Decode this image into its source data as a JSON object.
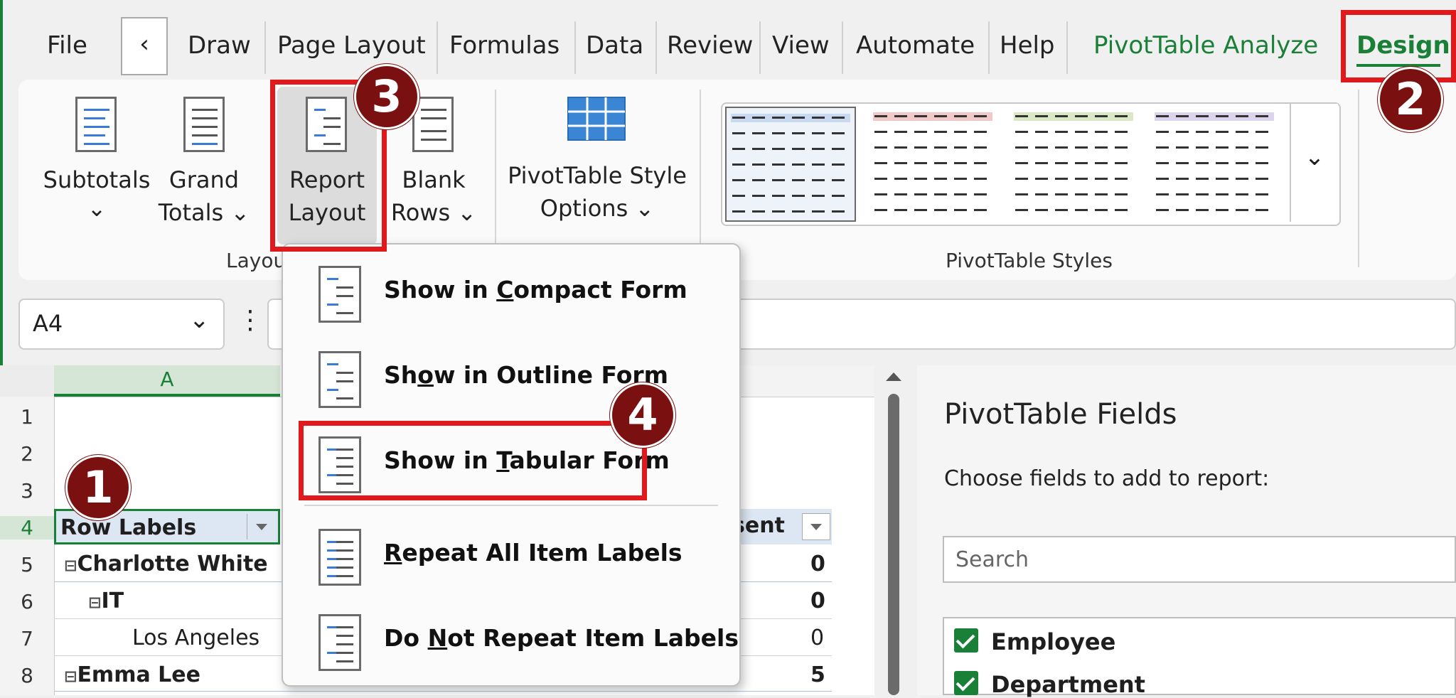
{
  "tabs": {
    "file": "File",
    "back": "‹",
    "draw": "Draw",
    "page_layout": "Page Layout",
    "formulas": "Formulas",
    "data": "Data",
    "review": "Review",
    "view": "View",
    "automate": "Automate",
    "help": "Help",
    "pivot_analyze": "PivotTable Analyze",
    "design": "Design"
  },
  "ribbon": {
    "subtotals": "Subtotals",
    "subtotals_caret": "⌄",
    "grand": "Grand",
    "totals": "Totals ⌄",
    "report": "Report",
    "layout": "Layout ⌄",
    "blank": "Blank",
    "rows": "Rows ⌄",
    "style_options_1": "PivotTable Style",
    "style_options_2": "Options ⌄",
    "group_layout": "Layou",
    "group_styles": "PivotTable Styles",
    "more": "⌄"
  },
  "menu": {
    "compact_pre": "Show in ",
    "compact_key": "C",
    "compact_post": "ompact Form",
    "outline_pre": "Sh",
    "outline_key": "o",
    "outline_post": "w in Outline Form",
    "tabular_pre": "Show in ",
    "tabular_key": "T",
    "tabular_post": "abular Form",
    "repeat_key": "R",
    "repeat_post": "epeat All Item Labels",
    "norepeat_pre": "Do ",
    "norepeat_key": "N",
    "norepeat_post": "ot Repeat Item Labels"
  },
  "namebox": {
    "value": "A4",
    "caret": "⌄",
    "dots": "⋮"
  },
  "sheet": {
    "col_a": "A",
    "row_nums": [
      "1",
      "2",
      "3",
      "4",
      "5",
      "6",
      "7",
      "8"
    ],
    "row_labels_header": "Row Labels",
    "header_right": "sent",
    "rows": [
      {
        "label": "Charlotte White",
        "value": "0"
      },
      {
        "label": "IT",
        "value": "0"
      },
      {
        "label": "Los Angeles",
        "value": "0"
      },
      {
        "label": "Emma Lee",
        "value": "5"
      }
    ],
    "collapse": "⊟"
  },
  "fields": {
    "title": "PivotTable Fields",
    "choose": "Choose fields to add to report:",
    "search_placeholder": "Search",
    "items": [
      "Employee",
      "Department"
    ]
  },
  "badges": [
    "1",
    "2",
    "3",
    "4"
  ],
  "colors": {
    "accent_green": "#1a7f37",
    "highlight_red": "#e0191d",
    "badge": "#7a1010"
  }
}
